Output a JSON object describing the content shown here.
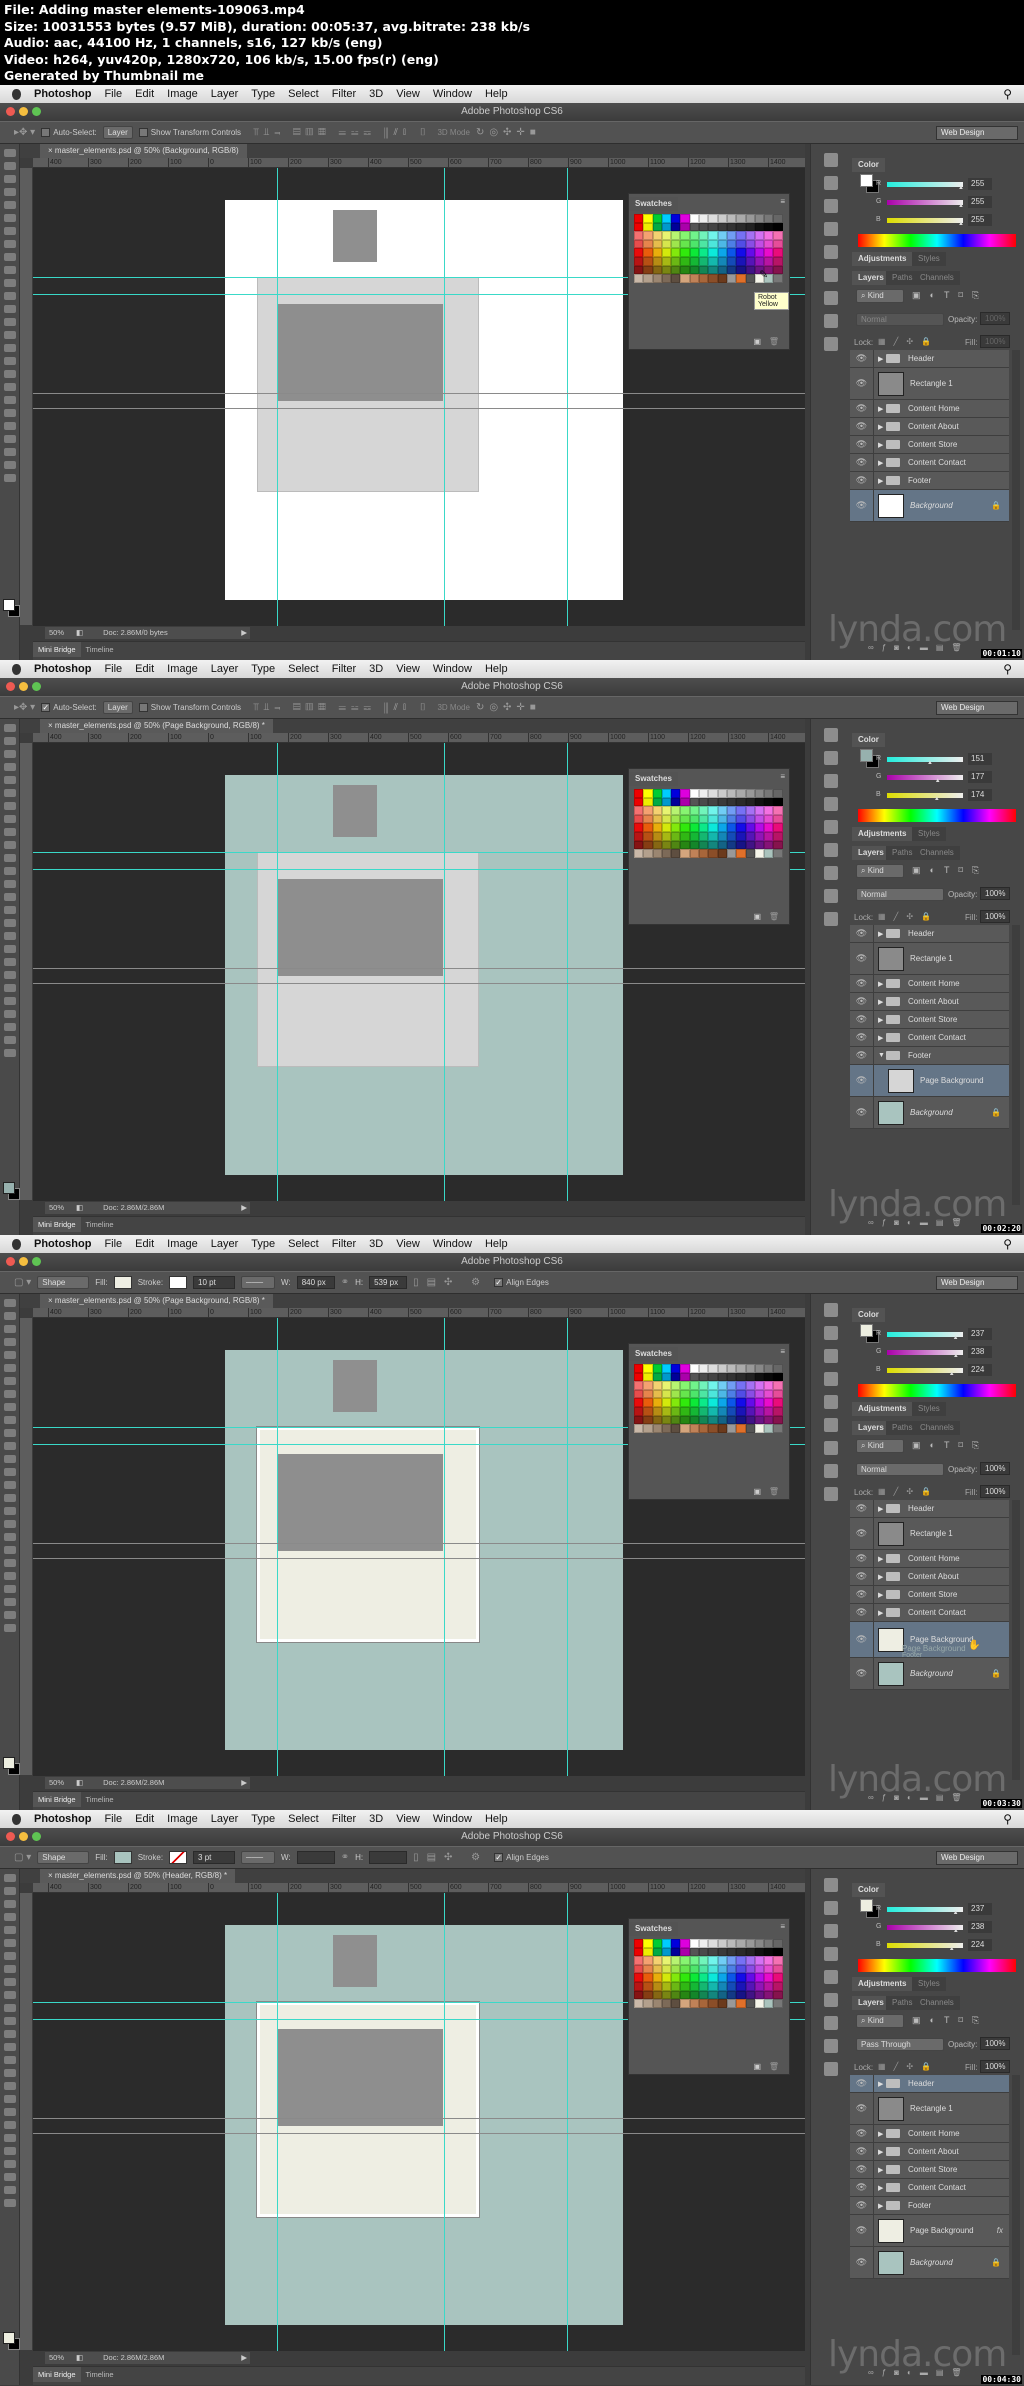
{
  "info": {
    "lines": [
      "File: Adding master elements-109063.mp4",
      "Size: 10031553 bytes (9.57 MiB), duration: 00:05:37, avg.bitrate: 238 kb/s",
      "Audio: aac, 44100 Hz, 1 channels, s16, 127 kb/s (eng)",
      "Video: h264, yuv420p, 1280x720, 106 kb/s, 15.00 fps(r) (eng)",
      "Generated by Thumbnail me"
    ]
  },
  "common": {
    "menu": [
      "Photoshop",
      "File",
      "Edit",
      "Image",
      "Layer",
      "Type",
      "Select",
      "Filter",
      "3D",
      "View",
      "Window",
      "Help"
    ],
    "window_title": "Adobe Photoshop CS6",
    "workspace": "Web Design",
    "ruler_labels": [
      "400",
      "300",
      "200",
      "100",
      "0",
      "100",
      "200",
      "300",
      "400",
      "500",
      "600",
      "700",
      "800",
      "900",
      "1000",
      "1100",
      "1200",
      "1300",
      "1400"
    ],
    "zoom": "50%",
    "mini_bridge": "Mini Bridge",
    "timeline": "Timeline",
    "color_tab": "Color",
    "adjustments_tab": "Adjustments",
    "styles_tab": "Styles",
    "layers_tab": "Layers",
    "paths_tab": "Paths",
    "channels_tab": "Channels",
    "kind": "Kind",
    "opacity_label": "Opacity:",
    "fill_label": "Fill:",
    "lock_label": "Lock:",
    "swatches_title": "Swatches",
    "watermark": "lynda.com",
    "move_options": {
      "auto_select": "Auto-Select:",
      "layer": "Layer",
      "show_transform": "Show Transform Controls",
      "mode_3d": "3D Mode"
    },
    "shape_options": {
      "mode": "Shape",
      "fill": "Fill:",
      "stroke": "Stroke:",
      "w": "W:",
      "h": "H:",
      "align_edges": "Align Edges"
    },
    "rgb_labels": [
      "R",
      "G",
      "B"
    ]
  },
  "frames": [
    {
      "tool": "move",
      "auto_select_checked": false,
      "doc_tab": "master_elements.psd @ 50% (Background, RGB/8)",
      "doc_status": "Doc: 2.86M/0 bytes",
      "timestamp": "00:01:10",
      "doc_bg": "#ffffff",
      "panel_fill": "#d6d6d6",
      "panel_border": false,
      "color": {
        "swatch": "#ffffff",
        "r": "255",
        "g": "255",
        "b": "255"
      },
      "blend": "Normal",
      "blend_disabled": true,
      "opacity": "100%",
      "fill": "100%",
      "tooltip": "Robot Yellow",
      "layers": [
        {
          "name": "Header",
          "type": "folder"
        },
        {
          "name": "Rectangle 1",
          "type": "shape",
          "thumb": "#8a8a8a"
        },
        {
          "name": "Content Home",
          "type": "folder"
        },
        {
          "name": "Content About",
          "type": "folder"
        },
        {
          "name": "Content Store",
          "type": "folder"
        },
        {
          "name": "Content Contact",
          "type": "folder"
        },
        {
          "name": "Footer",
          "type": "folder"
        },
        {
          "name": "Background",
          "type": "bg",
          "thumb": "#ffffff",
          "selected": true
        }
      ]
    },
    {
      "tool": "move",
      "auto_select_checked": true,
      "doc_tab": "master_elements.psd @ 50% (Page Background, RGB/8) *",
      "doc_status": "Doc: 2.86M/2.86M",
      "timestamp": "00:02:20",
      "doc_bg": "#a9c4bf",
      "panel_fill": "#d6d6d6",
      "panel_border": false,
      "color": {
        "swatch": "#97b1ae",
        "r": "151",
        "g": "177",
        "b": "174"
      },
      "blend": "Normal",
      "blend_disabled": false,
      "opacity": "100%",
      "fill": "100%",
      "layers": [
        {
          "name": "Header",
          "type": "folder"
        },
        {
          "name": "Rectangle 1",
          "type": "shape",
          "thumb": "#8a8a8a"
        },
        {
          "name": "Content Home",
          "type": "folder"
        },
        {
          "name": "Content About",
          "type": "folder"
        },
        {
          "name": "Content Store",
          "type": "folder"
        },
        {
          "name": "Content Contact",
          "type": "folder"
        },
        {
          "name": "Footer",
          "type": "folder",
          "expanded": true
        },
        {
          "name": "Page Background",
          "type": "shape",
          "thumb": "#d6d6d6",
          "selected": true,
          "indent": true
        },
        {
          "name": "Background",
          "type": "bg",
          "thumb": "#a9c4bf"
        }
      ]
    },
    {
      "tool": "shape",
      "stroke_width": "10 pt",
      "width": "840 px",
      "height": "539 px",
      "shape_fill": "#eeeee3",
      "stroke_none": false,
      "doc_tab": "master_elements.psd @ 50% (Page Background, RGB/8) *",
      "doc_status": "Doc: 2.86M/2.86M",
      "timestamp": "00:03:30",
      "doc_bg": "#a9c4bf",
      "panel_fill": "#eeeee3",
      "panel_border": true,
      "color": {
        "swatch": "#edeee0",
        "r": "237",
        "g": "238",
        "b": "224"
      },
      "blend": "Normal",
      "blend_disabled": false,
      "opacity": "100%",
      "fill": "100%",
      "layers": [
        {
          "name": "Header",
          "type": "folder"
        },
        {
          "name": "Rectangle 1",
          "type": "shape",
          "thumb": "#8a8a8a"
        },
        {
          "name": "Content Home",
          "type": "folder"
        },
        {
          "name": "Content About",
          "type": "folder"
        },
        {
          "name": "Content Store",
          "type": "folder"
        },
        {
          "name": "Content Contact",
          "type": "folder"
        },
        {
          "name": "Page Background",
          "type": "shape",
          "thumb": "#eeeee3",
          "selected": true,
          "dragging": true,
          "ghost": "Page Background",
          "ghost2": "Footer"
        },
        {
          "name": "Background",
          "type": "bg",
          "thumb": "#a9c4bf"
        }
      ]
    },
    {
      "tool": "shape",
      "stroke_width": "3 pt",
      "width": "",
      "height": "",
      "shape_fill": "#a9c4bf",
      "stroke_none": true,
      "doc_tab": "master_elements.psd @ 50% (Header, RGB/8) *",
      "doc_status": "Doc: 2.86M/2.86M",
      "timestamp": "00:04:30",
      "doc_bg": "#a9c4bf",
      "panel_fill": "#eeeee3",
      "panel_border": true,
      "color": {
        "swatch": "#edeee0",
        "r": "237",
        "g": "238",
        "b": "224"
      },
      "blend": "Pass Through",
      "blend_disabled": false,
      "opacity": "100%",
      "fill": "100%",
      "layers": [
        {
          "name": "Header",
          "type": "folder",
          "selected": true
        },
        {
          "name": "Rectangle 1",
          "type": "shape",
          "thumb": "#8a8a8a"
        },
        {
          "name": "Content Home",
          "type": "folder"
        },
        {
          "name": "Content About",
          "type": "folder"
        },
        {
          "name": "Content Store",
          "type": "folder"
        },
        {
          "name": "Content Contact",
          "type": "folder"
        },
        {
          "name": "Footer",
          "type": "folder"
        },
        {
          "name": "Page Background",
          "type": "shape",
          "thumb": "#eeeee3",
          "fx": "fx"
        },
        {
          "name": "Background",
          "type": "bg",
          "thumb": "#a9c4bf"
        }
      ]
    }
  ]
}
